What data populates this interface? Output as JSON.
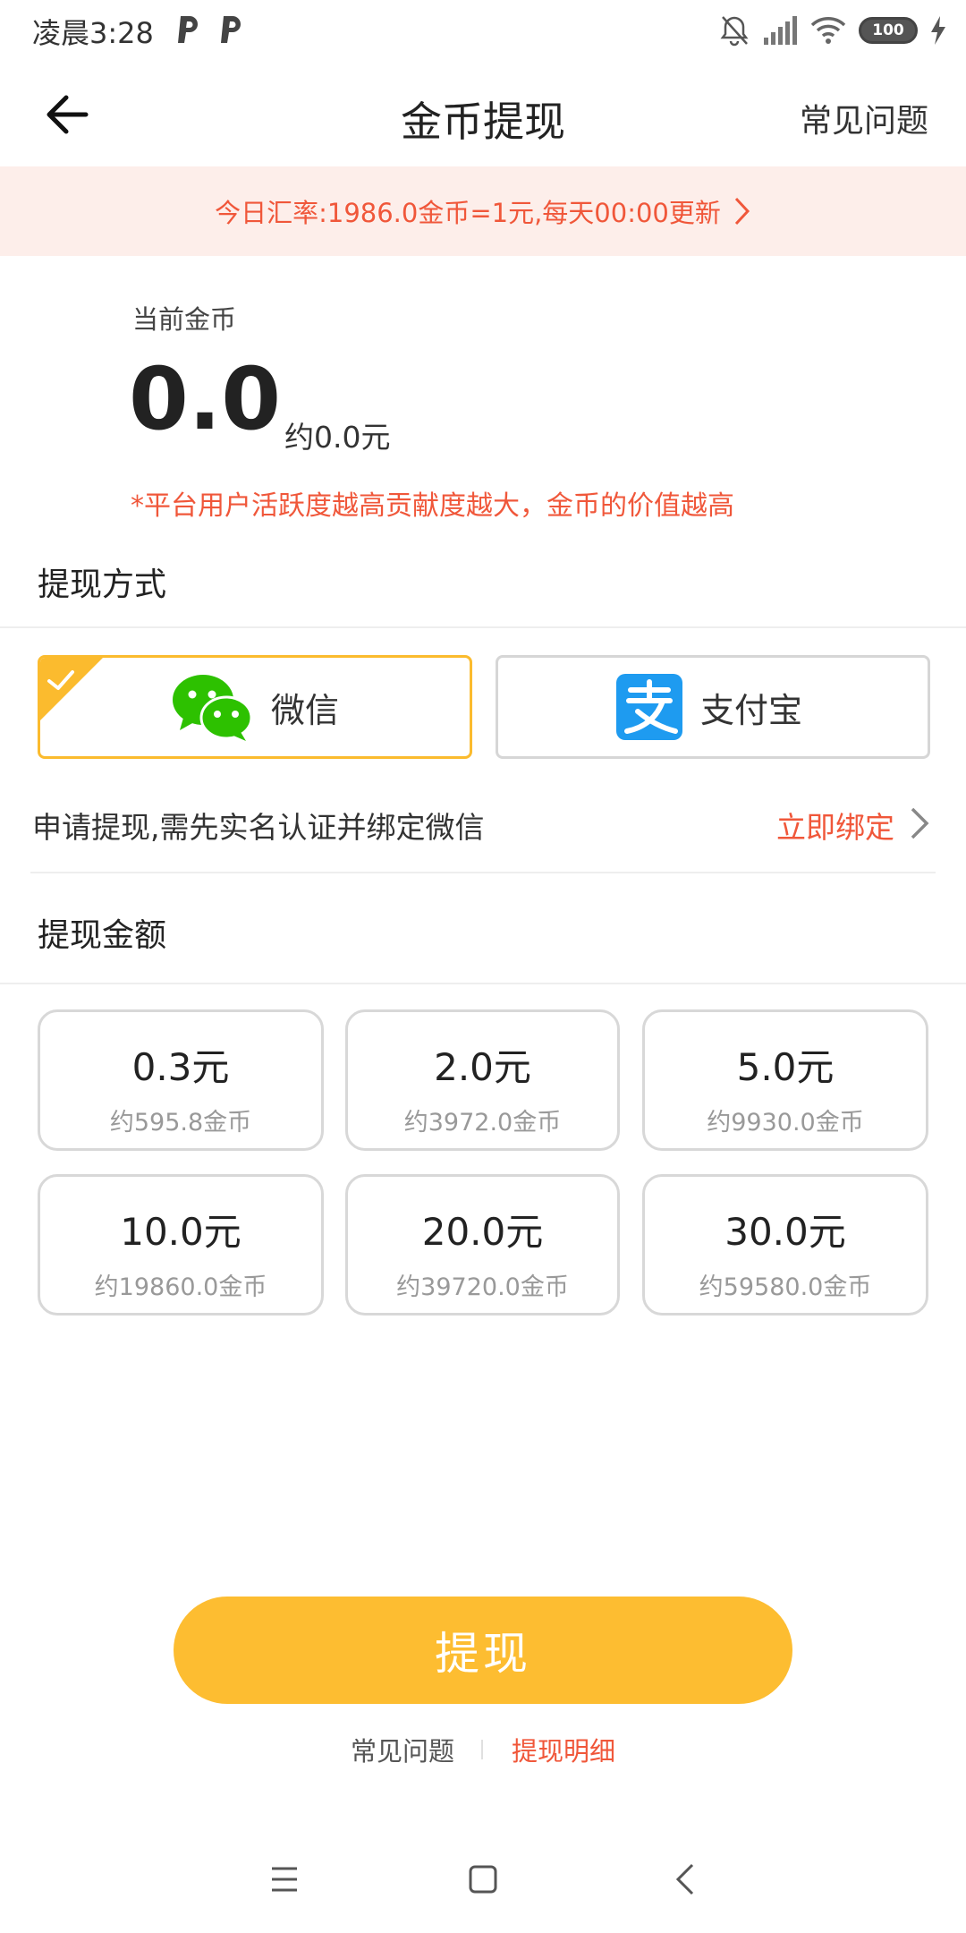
{
  "status_bar": {
    "time": "凌晨3:28",
    "icons": [
      "parking-p-icon",
      "parking-p-icon",
      "mute-bell-icon",
      "signal-icon",
      "wifi-icon",
      "battery-icon",
      "charging-icon"
    ],
    "battery_level": "100"
  },
  "header": {
    "title": "金币提现",
    "faq_label": "常见问题"
  },
  "rate_banner": {
    "text": "今日汇率:1986.0金币=1元,每天00:00更新"
  },
  "balance": {
    "label": "当前金币",
    "value": "0.0",
    "approx": "约0.0元",
    "note": "*平台用户活跃度越高贡献度越大，金币的价值越高"
  },
  "withdraw_method": {
    "title": "提现方式",
    "options": [
      {
        "label": "微信",
        "icon": "wechat-icon",
        "selected": true
      },
      {
        "label": "支付宝",
        "icon": "alipay-icon",
        "selected": false
      }
    ]
  },
  "bind_row": {
    "text": "申请提现,需先实名认证并绑定微信",
    "link": "立即绑定"
  },
  "amount_section": {
    "title": "提现金额",
    "options": [
      {
        "yuan": "0.3元",
        "coins": "约595.8金币"
      },
      {
        "yuan": "2.0元",
        "coins": "约3972.0金币"
      },
      {
        "yuan": "5.0元",
        "coins": "约9930.0金币"
      },
      {
        "yuan": "10.0元",
        "coins": "约19860.0金币"
      },
      {
        "yuan": "20.0元",
        "coins": "约39720.0金币"
      },
      {
        "yuan": "30.0元",
        "coins": "约59580.0金币"
      }
    ]
  },
  "actions": {
    "withdraw_label": "提现",
    "footer_faq": "常见问题",
    "footer_detail": "提现明细"
  },
  "colors": {
    "accent": "#fdbd31",
    "warning_text": "#f0573a",
    "banner_bg": "#fdeeea",
    "wechat_green": "#2dc100",
    "alipay_blue": "#1e9bf0"
  }
}
